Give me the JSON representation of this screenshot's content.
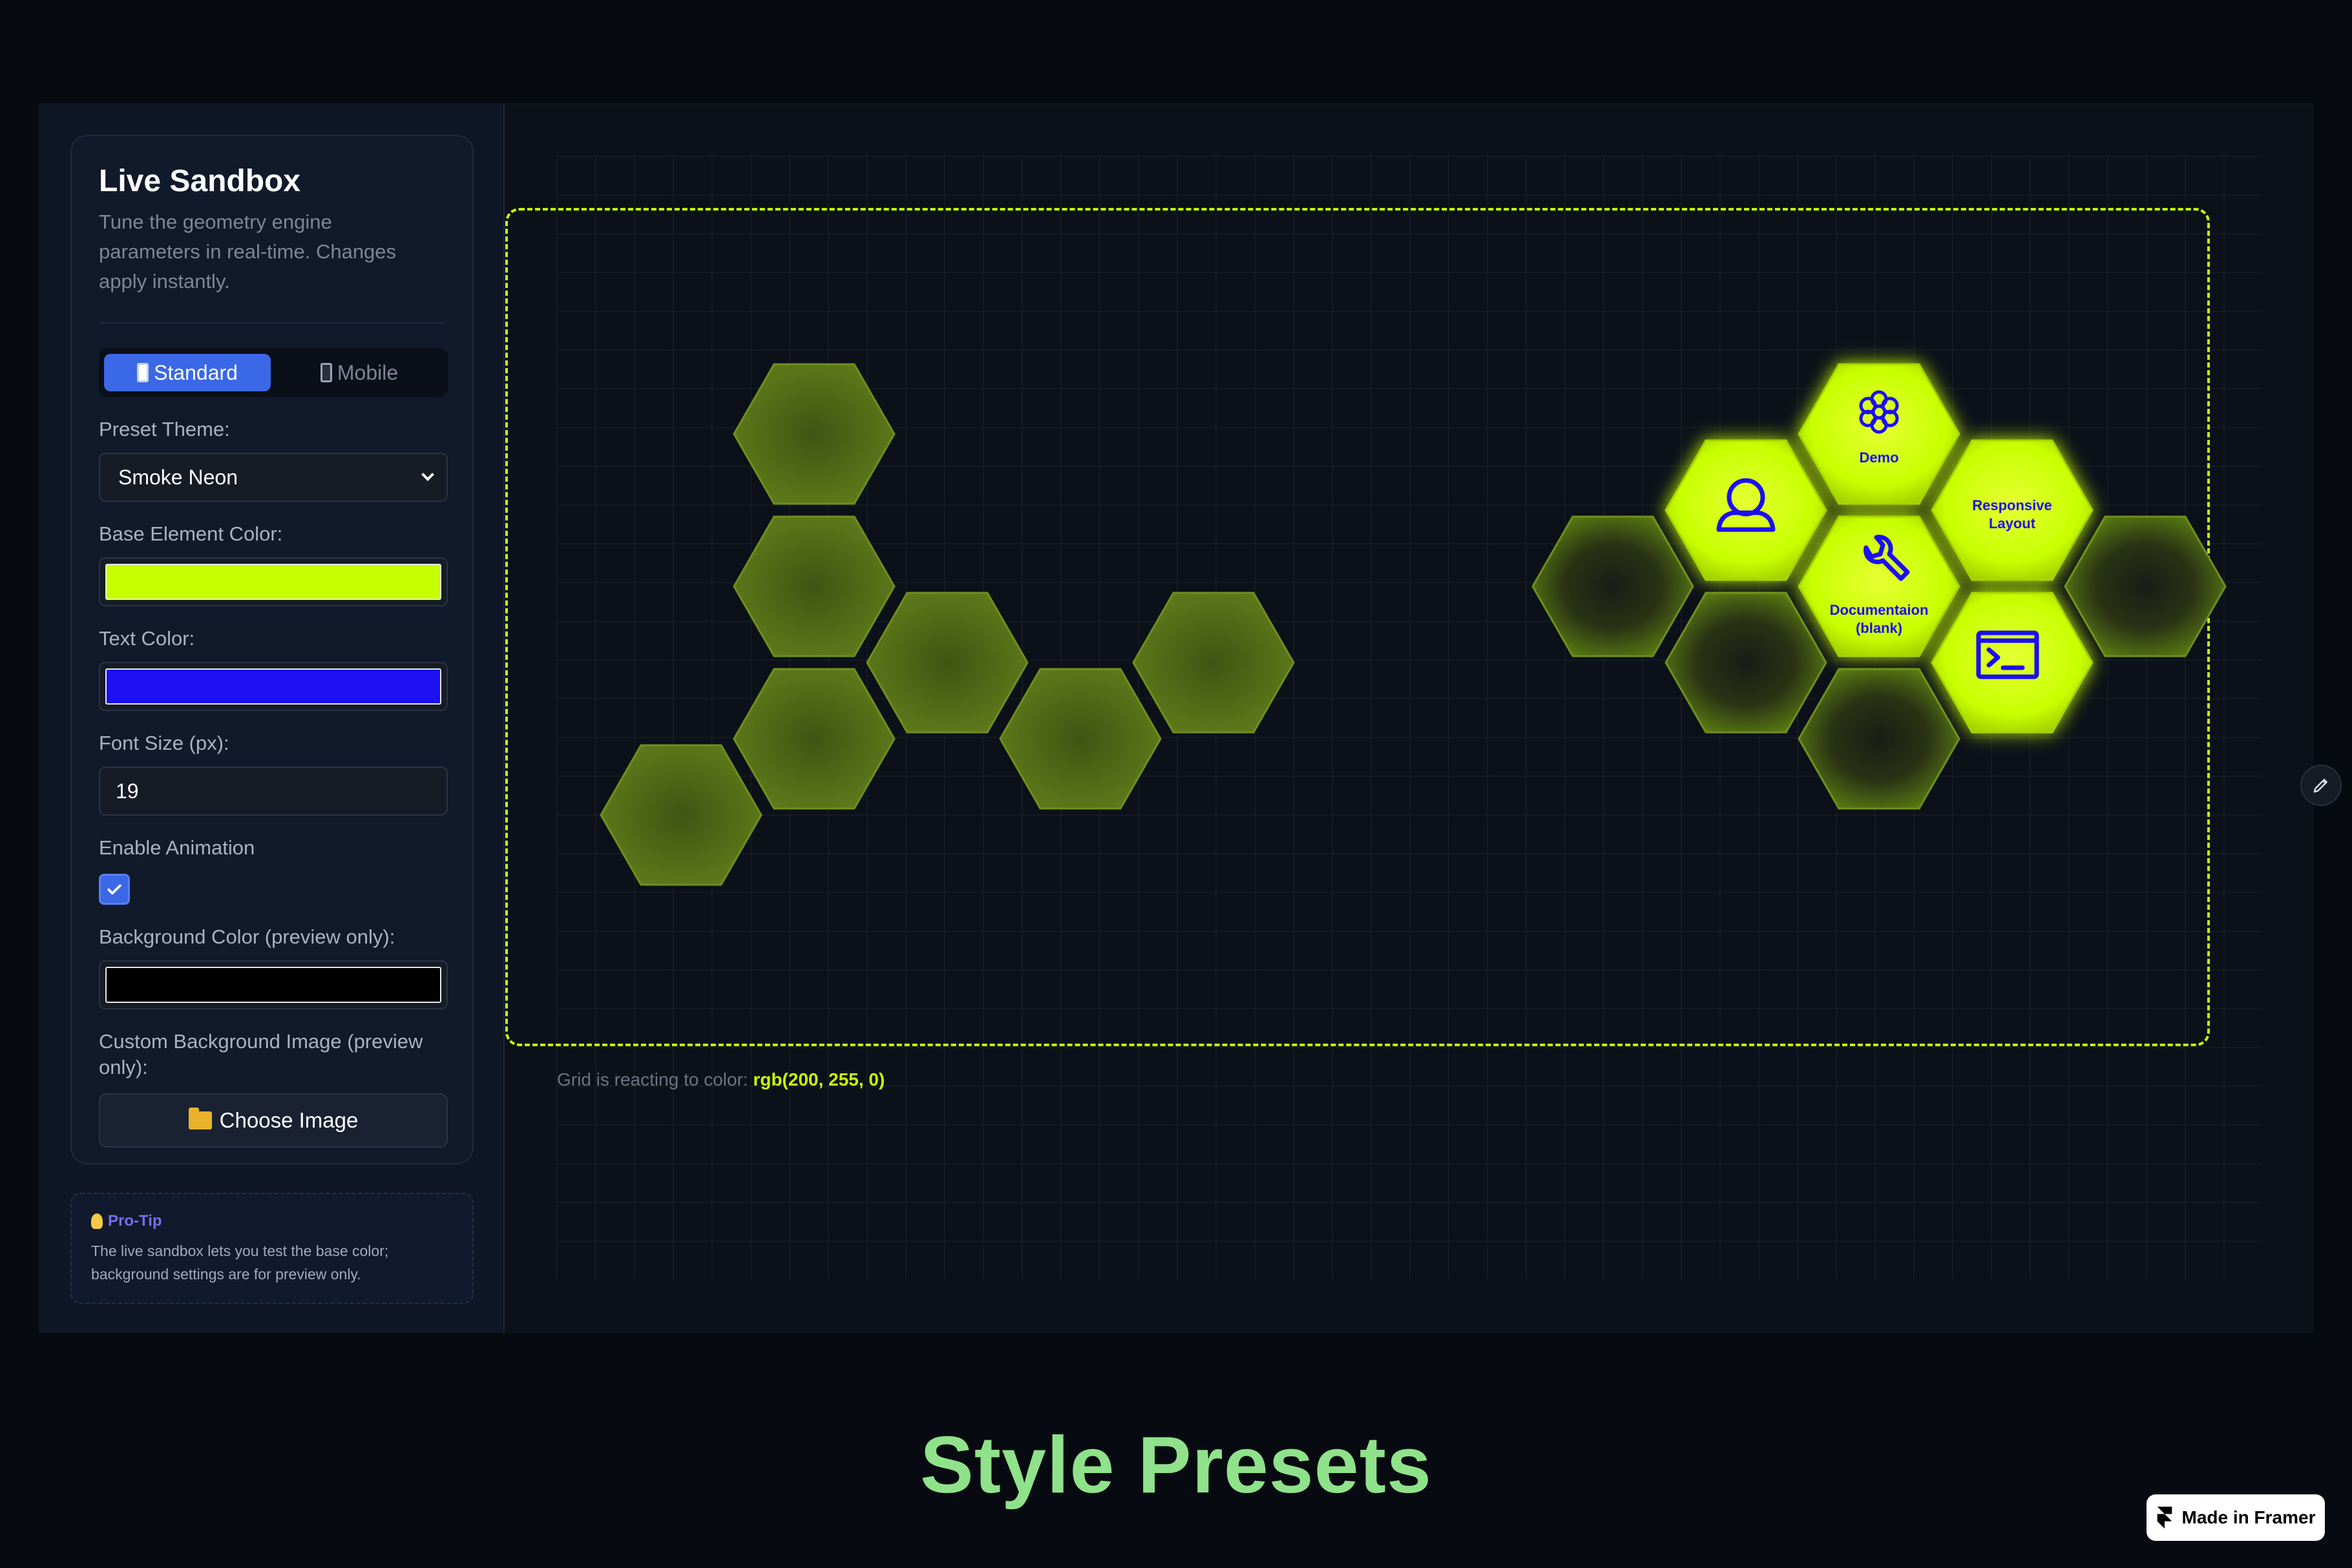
{
  "sidebar": {
    "title": "Live Sandbox",
    "description": "Tune the geometry engine parameters in real-time. Changes apply instantly.",
    "mode_toggle": {
      "standard": "Standard",
      "mobile": "Mobile",
      "active": "Standard"
    },
    "preset_label": "Preset Theme:",
    "preset_value": "Smoke Neon",
    "base_color_label": "Base Element Color:",
    "base_color": "#c8ff00",
    "text_color_label": "Text Color:",
    "text_color": "#1c0ff0",
    "font_size_label": "Font Size (px):",
    "font_size_value": "19",
    "animation_label": "Enable Animation",
    "animation_enabled": true,
    "bg_color_label": "Background Color (preview only):",
    "bg_color": "#000000",
    "bg_image_label": "Custom Background Image (preview only):",
    "choose_image_label": "Choose Image"
  },
  "tip": {
    "title": "Pro-Tip",
    "text": "The live sandbox lets you test the base color; background settings are for preview only."
  },
  "canvas": {
    "caption_prefix": "Grid is reacting to color:",
    "caption_value": "rgb(200, 255, 0)",
    "hex_items": [
      {
        "label": "",
        "icon": "user-icon"
      },
      {
        "label": "Demo",
        "icon": "flower-icon"
      },
      {
        "label": "Responsive\nLayout",
        "icon": ""
      },
      {
        "label": "Documentaion\n(blank)",
        "icon": "wrench-icon"
      },
      {
        "label": "",
        "icon": "terminal-icon"
      }
    ]
  },
  "headline": "Style Presets",
  "badge": "Made in Framer",
  "colors": {
    "accent": "#c8ff00",
    "primary": "#3b68e6",
    "headline": "#8fe28a"
  }
}
